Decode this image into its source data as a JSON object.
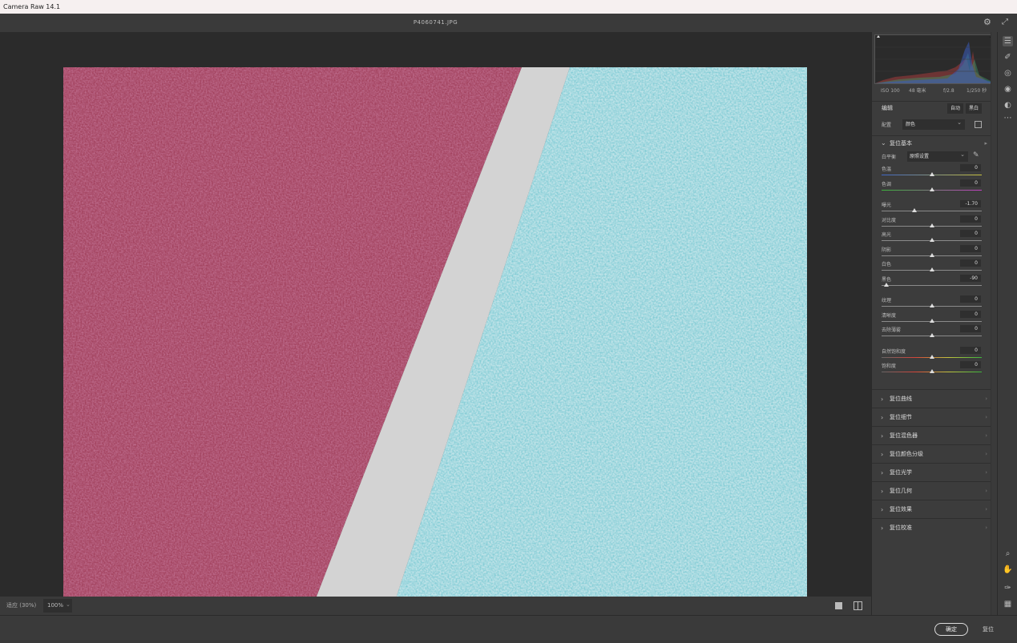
{
  "window": {
    "title": "Camera Raw 14.1"
  },
  "header": {
    "filename": "P4060741.JPG",
    "settings_icon": "gear-icon",
    "fullscreen_icon": "expand-icon"
  },
  "bottombar": {
    "zoom_label": "适应 (30%)",
    "zoom_value": "100%"
  },
  "footer": {
    "ok_label": "确定",
    "reset_label": "复位"
  },
  "camera_info": {
    "iso": "ISO 100",
    "focal": "48 毫米",
    "aperture": "f/2.8",
    "shutter": "1/250 秒"
  },
  "edit": {
    "title": "编辑",
    "auto_label": "自动",
    "bw_label": "黑白"
  },
  "profile": {
    "label": "配置",
    "value": "颜色"
  },
  "basic": {
    "title": "复位基本",
    "wb_label": "白平衡",
    "wb_value": "原照设置",
    "sliders": [
      {
        "label": "色温",
        "value": "0",
        "level": 0.5,
        "track": "temp"
      },
      {
        "label": "色调",
        "value": "0",
        "level": 0.5,
        "track": "tint"
      },
      {
        "label": "曝光",
        "value": "-1.70",
        "level": 0.33,
        "track": "plain",
        "gap_before": true
      },
      {
        "label": "对比度",
        "value": "0",
        "level": 0.5,
        "track": "plain"
      },
      {
        "label": "高光",
        "value": "0",
        "level": 0.5,
        "track": "plain"
      },
      {
        "label": "阴影",
        "value": "0",
        "level": 0.5,
        "track": "plain"
      },
      {
        "label": "白色",
        "value": "0",
        "level": 0.5,
        "track": "plain"
      },
      {
        "label": "黑色",
        "value": "-90",
        "level": 0.05,
        "track": "plain"
      },
      {
        "label": "纹理",
        "value": "0",
        "level": 0.5,
        "track": "plain",
        "gap_before": true
      },
      {
        "label": "清晰度",
        "value": "0",
        "level": 0.5,
        "track": "plain"
      },
      {
        "label": "去除薄雾",
        "value": "0",
        "level": 0.5,
        "track": "plain"
      },
      {
        "label": "自然饱和度",
        "value": "0",
        "level": 0.5,
        "track": "vib",
        "gap_before": true
      },
      {
        "label": "饱和度",
        "value": "0",
        "level": 0.5,
        "track": "vib"
      }
    ]
  },
  "sections": [
    "复位曲线",
    "复位细节",
    "复位混色器",
    "复位颜色分级",
    "复位光学",
    "复位几何",
    "复位效果",
    "复位校准"
  ],
  "tools": [
    "edit-sliders-icon",
    "healing-brush-icon",
    "mask-icon",
    "red-eye-icon",
    "presets-icon",
    "more-icon"
  ],
  "bottom_tools": [
    "zoom-icon",
    "hand-icon",
    "color-sampler-icon",
    "grid-icon"
  ],
  "colors": {
    "accent_pink": "#8a2d4f",
    "accent_cyan": "#5fc6d2",
    "stripe": "#d3d3d3",
    "panel": "#3c3c3c"
  }
}
